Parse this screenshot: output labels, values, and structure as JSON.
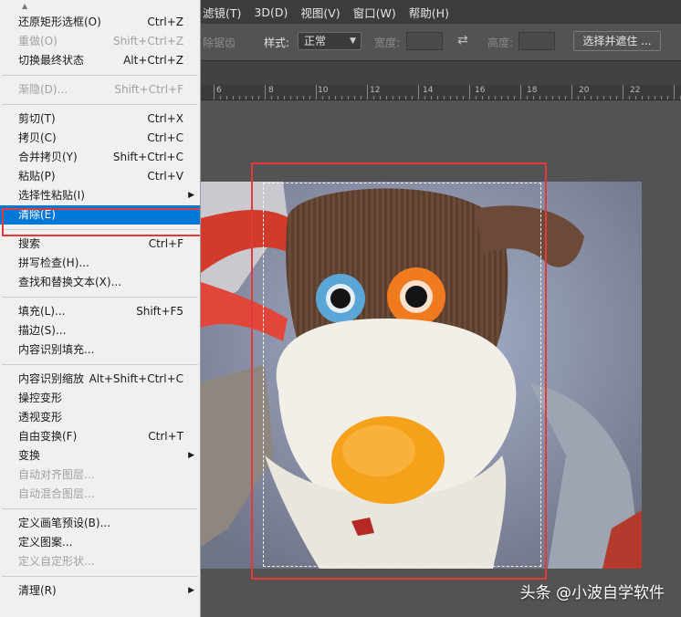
{
  "menubar": {
    "items": [
      "滤镜(T)",
      "3D(D)",
      "视图(V)",
      "窗口(W)",
      "帮助(H)"
    ]
  },
  "options": {
    "antialias_label": "除锯齿",
    "style_label": "样式:",
    "style_value": "正常",
    "width_label": "宽度:",
    "height_label": "高度:",
    "select_mask_button": "选择并遮住 ..."
  },
  "ruler": {
    "labels": [
      "6",
      "8",
      "10",
      "12",
      "14",
      "16",
      "18",
      "20",
      "22"
    ]
  },
  "edit_menu": {
    "groups": [
      [
        {
          "label": "还原矩形选框(O)",
          "shortcut": "Ctrl+Z",
          "state": "normal"
        },
        {
          "label": "重做(O)",
          "shortcut": "Shift+Ctrl+Z",
          "state": "disabled"
        },
        {
          "label": "切换最终状态",
          "shortcut": "Alt+Ctrl+Z",
          "state": "normal"
        }
      ],
      [
        {
          "label": "渐隐(D)...",
          "shortcut": "Shift+Ctrl+F",
          "state": "disabled"
        }
      ],
      [
        {
          "label": "剪切(T)",
          "shortcut": "Ctrl+X",
          "state": "normal"
        },
        {
          "label": "拷贝(C)",
          "shortcut": "Ctrl+C",
          "state": "normal"
        },
        {
          "label": "合并拷贝(Y)",
          "shortcut": "Shift+Ctrl+C",
          "state": "normal"
        },
        {
          "label": "粘贴(P)",
          "shortcut": "Ctrl+V",
          "state": "normal"
        },
        {
          "label": "选择性粘贴(I)",
          "shortcut": "",
          "state": "normal",
          "submenu": true
        },
        {
          "label": "清除(E)",
          "shortcut": "",
          "state": "active"
        }
      ],
      [
        {
          "label": "搜索",
          "shortcut": "Ctrl+F",
          "state": "normal"
        },
        {
          "label": "拼写检查(H)...",
          "shortcut": "",
          "state": "normal"
        },
        {
          "label": "查找和替换文本(X)...",
          "shortcut": "",
          "state": "normal"
        }
      ],
      [
        {
          "label": "填充(L)...",
          "shortcut": "Shift+F5",
          "state": "normal"
        },
        {
          "label": "描边(S)...",
          "shortcut": "",
          "state": "normal"
        },
        {
          "label": "内容识别填充...",
          "shortcut": "",
          "state": "normal"
        }
      ],
      [
        {
          "label": "内容识别缩放",
          "shortcut": "Alt+Shift+Ctrl+C",
          "state": "normal"
        },
        {
          "label": "操控变形",
          "shortcut": "",
          "state": "normal"
        },
        {
          "label": "透视变形",
          "shortcut": "",
          "state": "normal"
        },
        {
          "label": "自由变换(F)",
          "shortcut": "Ctrl+T",
          "state": "normal"
        },
        {
          "label": "变换",
          "shortcut": "",
          "state": "normal",
          "submenu": true
        },
        {
          "label": "自动对齐图层...",
          "shortcut": "",
          "state": "disabled"
        },
        {
          "label": "自动混合图层...",
          "shortcut": "",
          "state": "disabled"
        }
      ],
      [
        {
          "label": "定义画笔预设(B)...",
          "shortcut": "",
          "state": "normal"
        },
        {
          "label": "定义图案...",
          "shortcut": "",
          "state": "normal"
        },
        {
          "label": "定义自定形状...",
          "shortcut": "",
          "state": "disabled"
        }
      ],
      [
        {
          "label": "清理(R)",
          "shortcut": "",
          "state": "normal",
          "submenu": true
        }
      ]
    ]
  },
  "watermark": "头条 @小波自学软件",
  "colors": {
    "highlight": "#0078d7",
    "annotation": "#e03a3e"
  }
}
